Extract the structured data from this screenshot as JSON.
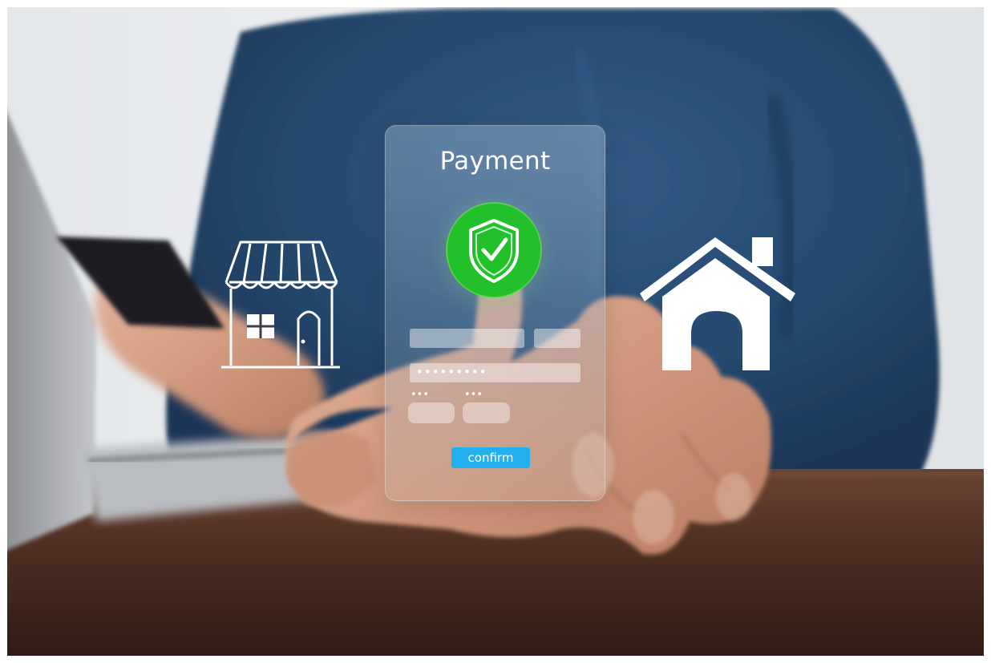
{
  "panel": {
    "title": "Payment",
    "password_mask": "•••••••••",
    "expiry_mask": "•••",
    "cvv_mask": "•••",
    "confirm_label": "confirm",
    "accent_color": "#23b0ee",
    "shield_color": "#22c02a"
  },
  "icons": {
    "left": "storefront-icon",
    "center": "shield-check-icon",
    "right": "house-icon"
  }
}
